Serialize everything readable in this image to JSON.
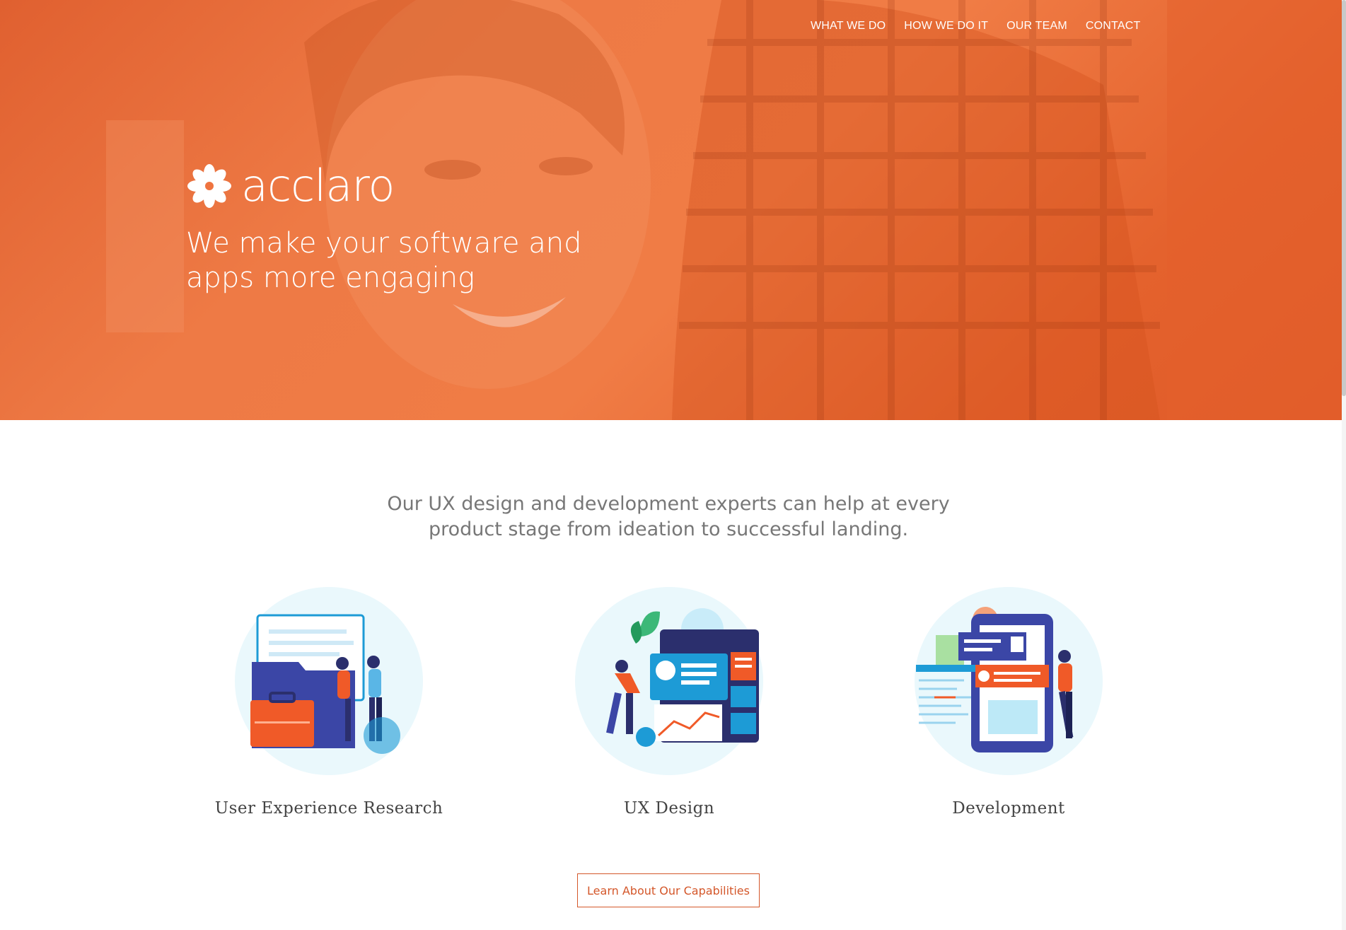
{
  "nav": {
    "items": [
      {
        "label": "WHAT WE DO"
      },
      {
        "label": "HOW WE DO IT"
      },
      {
        "label": "OUR TEAM"
      },
      {
        "label": "CONTACT"
      }
    ]
  },
  "hero": {
    "brand_name": "acclaro",
    "tagline": "We make your software and apps more engaging",
    "logo_icon": "flower-logo-icon"
  },
  "intro": {
    "text": "Our UX design and development experts can help at every product stage from ideation to successful landing."
  },
  "services": [
    {
      "title": "User Experience  Research",
      "icon": "research-illustration-icon"
    },
    {
      "title": "UX  Design",
      "icon": "design-illustration-icon"
    },
    {
      "title": "Development",
      "icon": "development-illustration-icon"
    }
  ],
  "cta": {
    "label": "Learn About Our Capabilities"
  },
  "colors": {
    "brand_orange": "#e8652f",
    "cta_border": "#d4572a",
    "illustration_blue": "#3b46a6",
    "illustration_orange": "#f05a28"
  }
}
